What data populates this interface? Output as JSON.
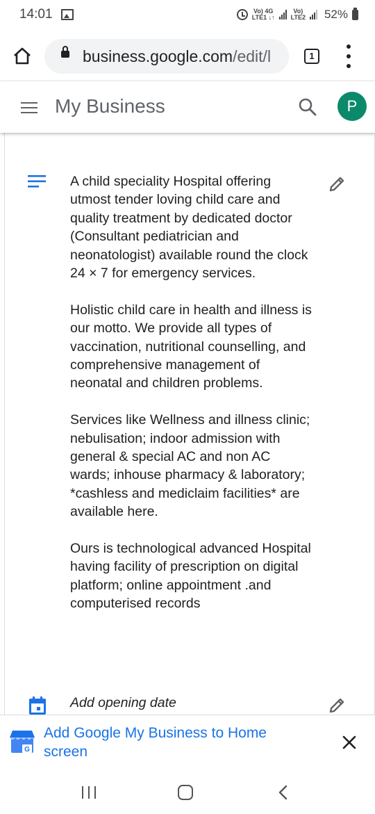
{
  "status_bar": {
    "time": "14:01",
    "sim1_label_top": "Vo) 4G",
    "sim1_label_bottom": "LTE1 ↓↑",
    "sim2_label_top": "Vo)",
    "sim2_label_bottom": "LTE2",
    "battery_percent": "52%"
  },
  "browser": {
    "url_domain": "business.google.com",
    "url_path": "/edit/l",
    "tab_count": "1"
  },
  "app_header": {
    "title": "My Business",
    "avatar_letter": "P",
    "avatar_color": "#0b8a6a"
  },
  "description": {
    "paragraphs": [
      "A child speciality Hospital offering utmost tender loving child care and quality treatment by dedicated doctor (Consultant pediatrician and neonatologist) available round the clock 24 × 7 for emergency services.",
      "Holistic child care in health and illness is our motto. We provide all types of vaccination, nutritional counselling, and comprehensive management of neonatal and children problems.",
      "Services like Wellness and illness clinic; nebulisation; indoor admission with general & special AC and non AC wards; inhouse pharmacy & laboratory; *cashless and mediclaim facilities* are available here.",
      "Ours is technological advanced Hospital having facility of prescription on digital platform; online appointment .and computerised records"
    ]
  },
  "opening_date": {
    "label": "Add opening date"
  },
  "install_banner": {
    "text": "Add Google My Business to Home screen"
  },
  "colors": {
    "accent": "#1a73e8",
    "text": "#202124",
    "muted": "#5f6368"
  }
}
